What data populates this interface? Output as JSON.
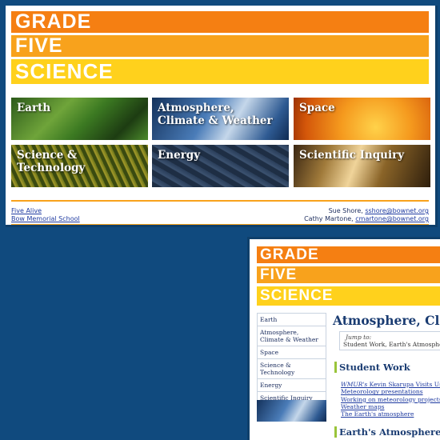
{
  "home": {
    "banner": {
      "line1": "GRADE",
      "line2": "FIVE",
      "line3": "SCIENCE"
    },
    "tiles": [
      {
        "label": "Earth"
      },
      {
        "label": "Atmosphere,\nClimate & Weather"
      },
      {
        "label": "Space"
      },
      {
        "label": "Science & Technology"
      },
      {
        "label": "Energy"
      },
      {
        "label": "Scientific Inquiry"
      }
    ],
    "footer": {
      "left_link1": "Five Alive",
      "left_link2": "Bow Memorial School",
      "contact1_name": "Sue Shore, ",
      "contact1_email": "sshore@bownet.org",
      "contact2_name": "Cathy Martone, ",
      "contact2_email": "cmartone@bownet.org"
    }
  },
  "inner": {
    "banner": {
      "line1": "GRADE",
      "line2": "FIVE",
      "line3": "SCIENCE"
    },
    "nav": [
      "Earth",
      "Atmosphere, Climate & Weather",
      "Space",
      "Science & Technology",
      "Energy",
      "Scientific Inquiry"
    ],
    "page_title": "Atmosphere, Cli",
    "jump": {
      "label": "Jump to:",
      "links": "Student Work,  Earth's Atmosphere"
    },
    "section1": "Student Work",
    "student_links": {
      "item1_em": "WMUR's",
      "item1_rest": " Kevin Skarupa Visits Us",
      "item2": "Meteorology presentations",
      "item3": "Working on meteorology projects",
      "item4": "Weather maps",
      "item5": "The Earth's atmosphere"
    },
    "section2": "Earth's Atmosphere"
  },
  "colors": {
    "background": "#104a7e",
    "band_orange": "#f57f12",
    "band_amber": "#f8a21c",
    "band_yellow": "#ffd11c",
    "heading_blue": "#1a3c72",
    "section_accent": "#9ac43a"
  }
}
